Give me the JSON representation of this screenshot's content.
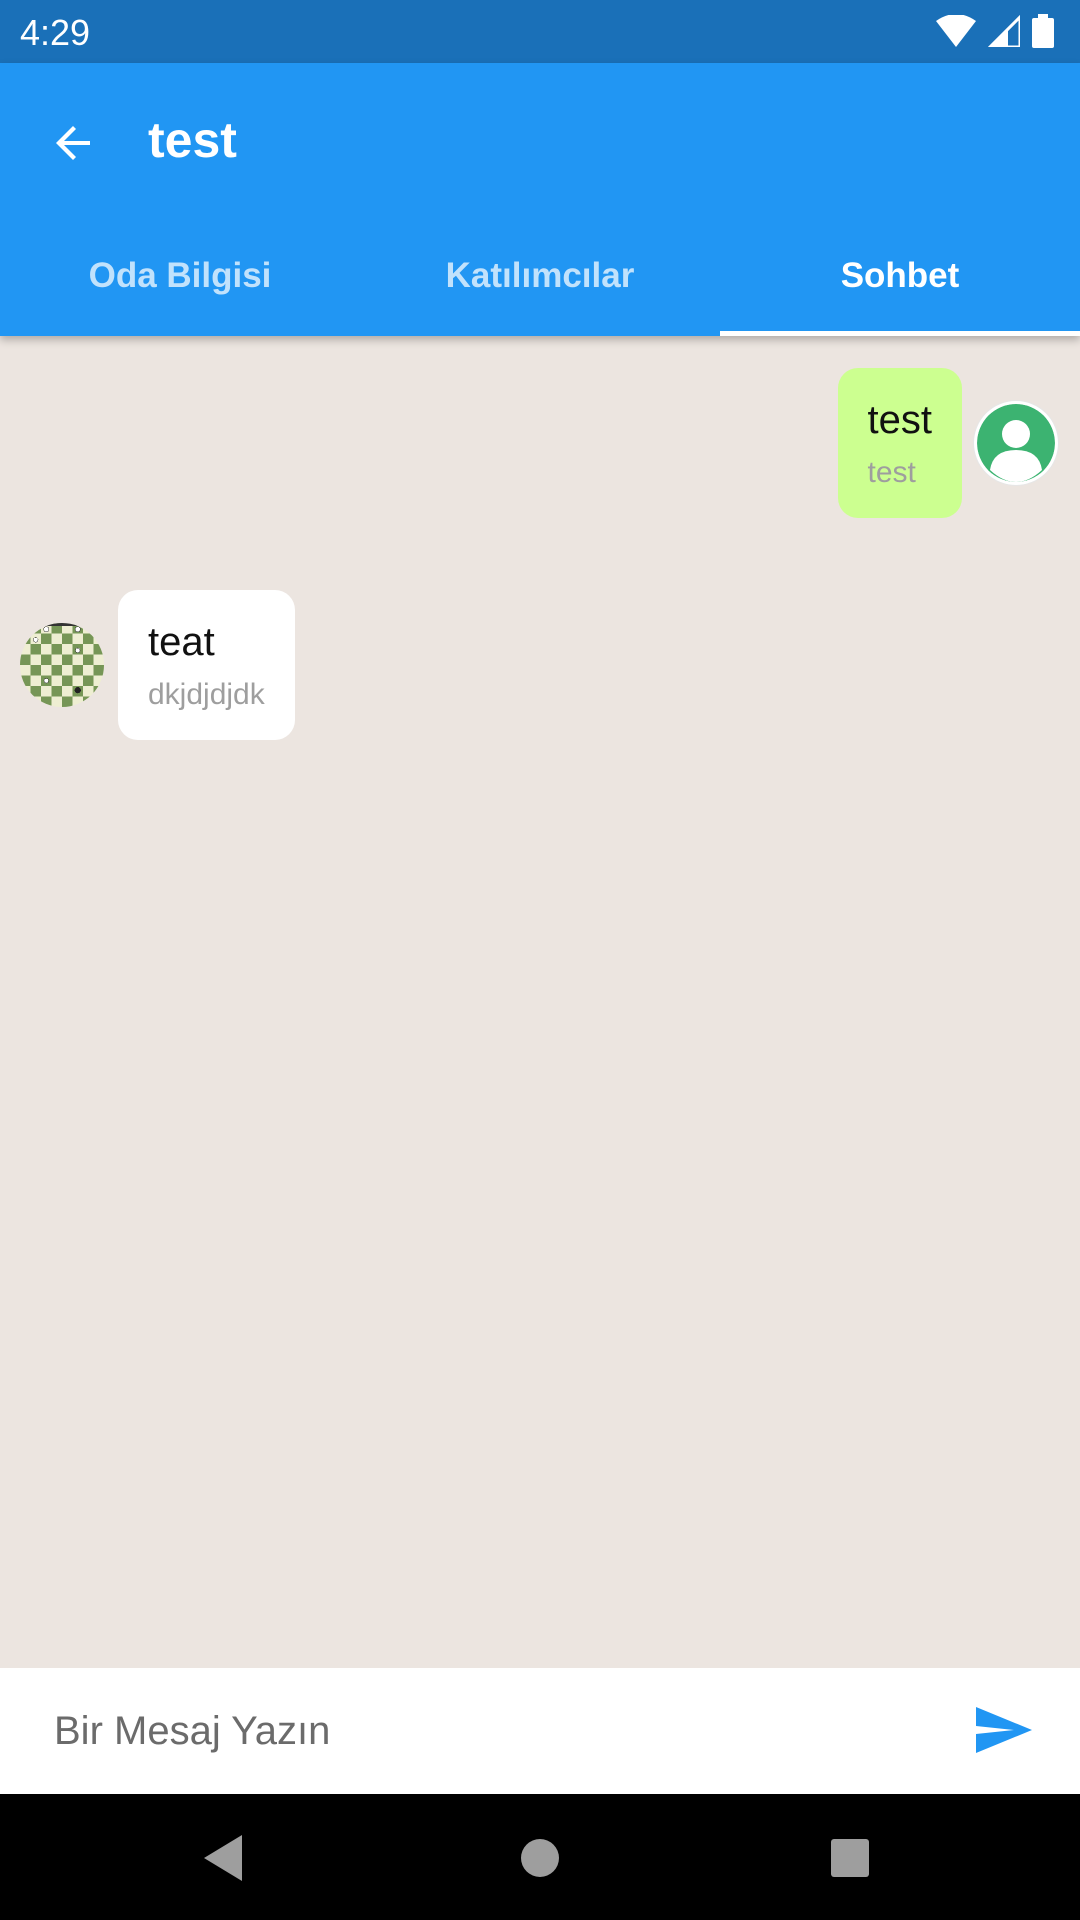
{
  "status_bar": {
    "time": "4:29",
    "icons": [
      "wifi-icon",
      "cellular-signal-icon",
      "battery-icon"
    ]
  },
  "app_bar": {
    "back_icon": "arrow-back-icon",
    "title": "test",
    "color": "#2196F3",
    "tabs": [
      {
        "label": "Oda Bilgisi",
        "active": false
      },
      {
        "label": "Katılımcılar",
        "active": false
      },
      {
        "label": "Sohbet",
        "active": true
      }
    ]
  },
  "messages": [
    {
      "side": "right",
      "text": "test",
      "sender": "test",
      "bubble_color": "#CCFF90",
      "avatar": "user-avatar-icon"
    },
    {
      "side": "left",
      "text": "teat",
      "sender": "dkjdjdjdk",
      "bubble_color": "#FFFFFF",
      "avatar": "chessboard-avatar"
    }
  ],
  "composer": {
    "placeholder": "Bir Mesaj Yazın",
    "send_icon": "send-icon",
    "accent": "#2196F3"
  },
  "nav_bar": {
    "icons": [
      "nav-back-icon",
      "nav-home-icon",
      "nav-recents-icon"
    ]
  }
}
